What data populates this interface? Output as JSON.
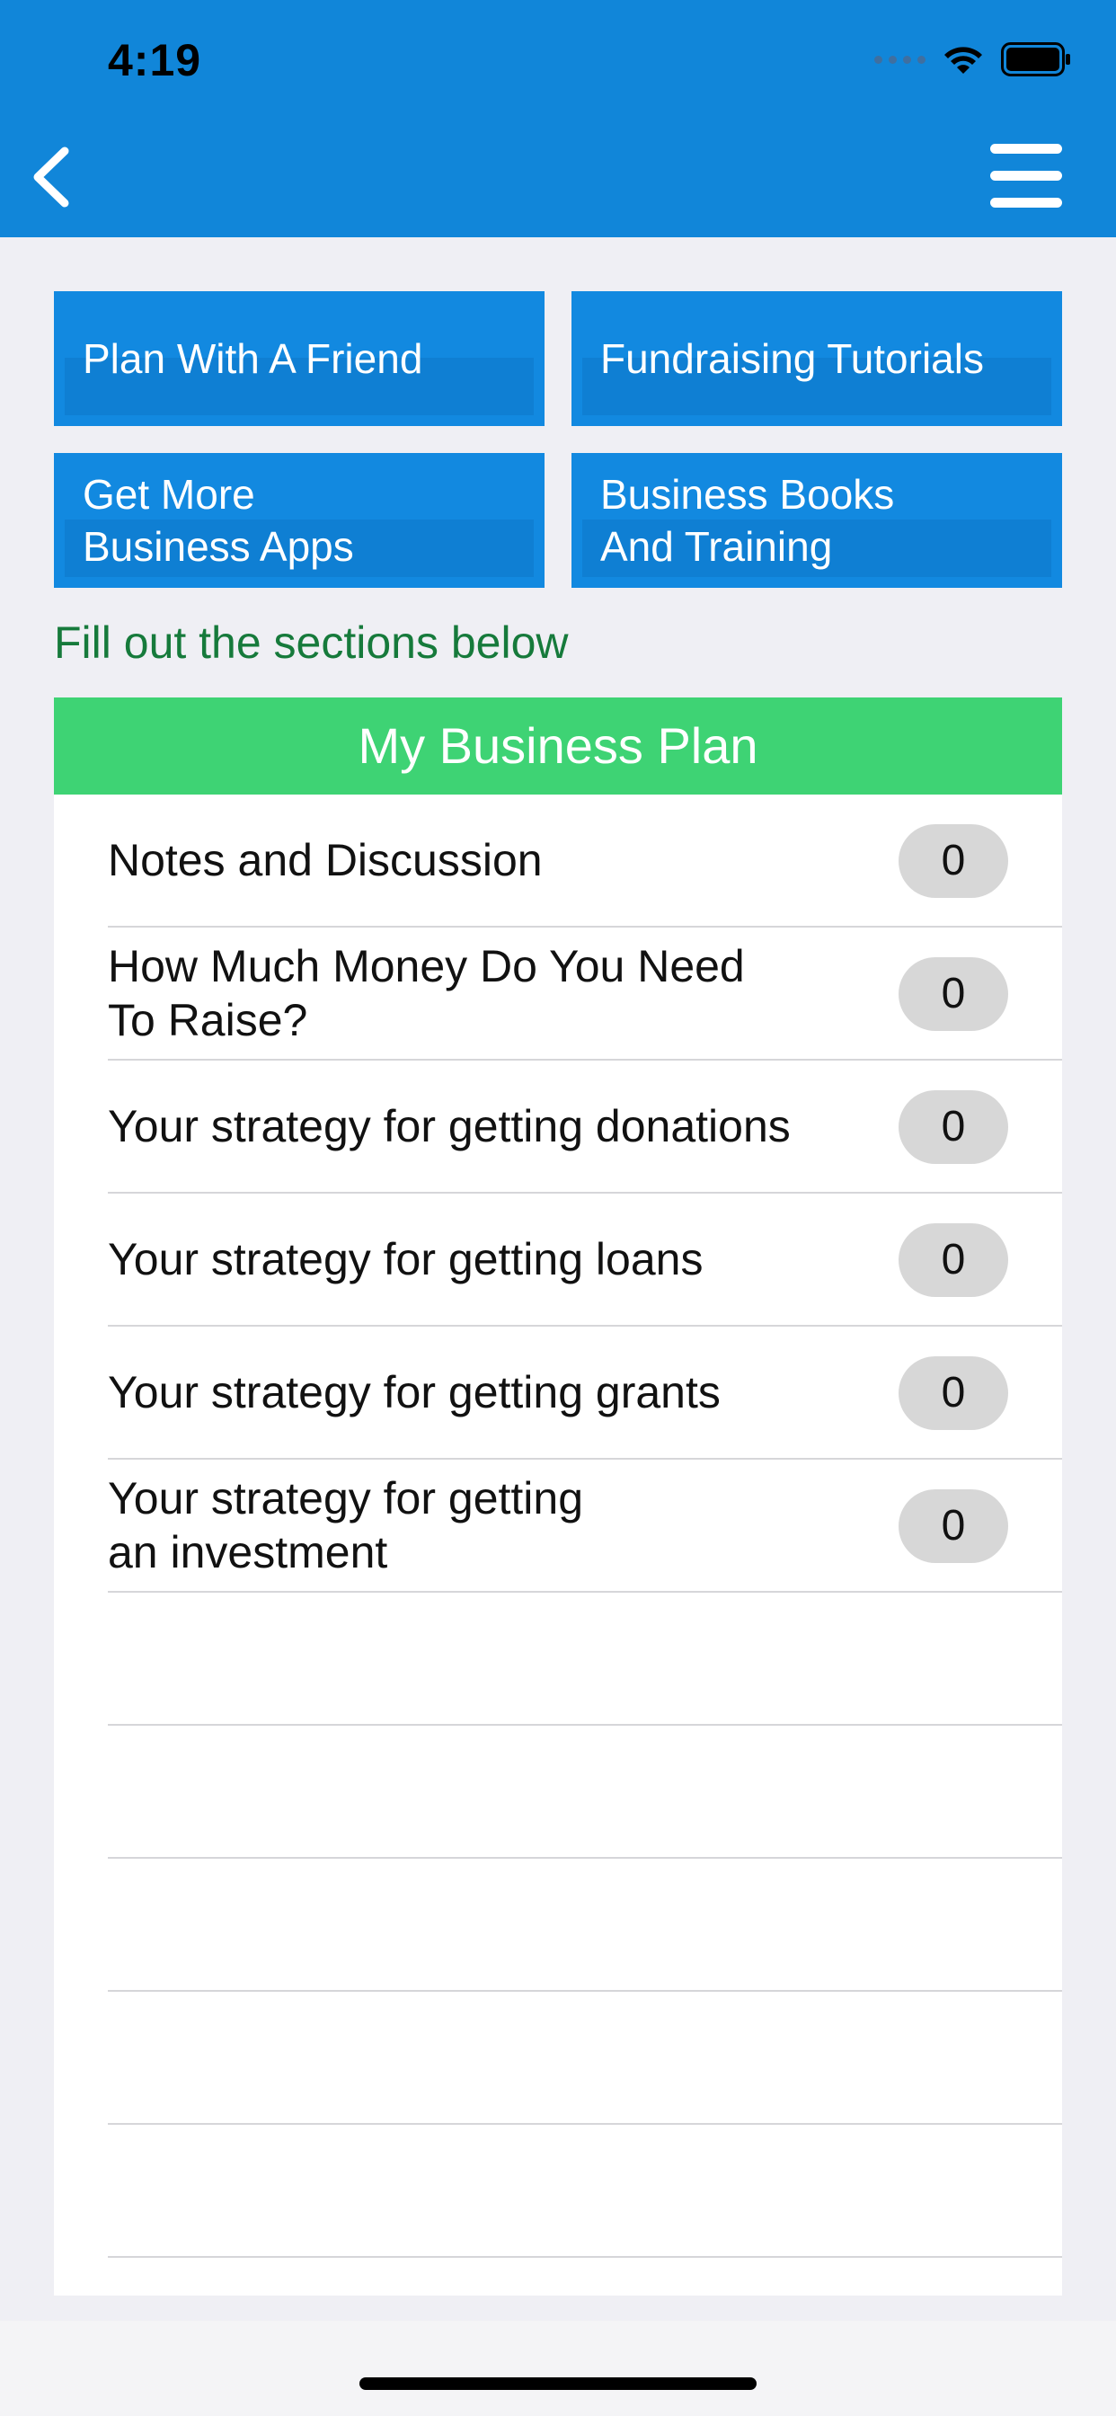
{
  "status_bar": {
    "time": "4:19"
  },
  "nav": {
    "back_icon": "chevron-left-icon",
    "menu_icon": "hamburger-menu-icon"
  },
  "quick_buttons": [
    {
      "label": "Plan With A Friend"
    },
    {
      "label": "Fundraising Tutorials"
    },
    {
      "label": "Get More\nBusiness Apps"
    },
    {
      "label": "Business Books\nAnd Training"
    }
  ],
  "instruction": "Fill out the sections below",
  "plan": {
    "title": "My Business Plan",
    "rows": [
      {
        "label": "Notes and Discussion",
        "count": "0"
      },
      {
        "label": "How Much Money Do You Need\nTo Raise?",
        "count": "0"
      },
      {
        "label": "Your strategy for getting donations",
        "count": "0"
      },
      {
        "label": "Your strategy for getting loans",
        "count": "0"
      },
      {
        "label": "Your strategy for getting grants",
        "count": "0"
      },
      {
        "label": "Your strategy for getting\nan investment",
        "count": "0"
      }
    ]
  },
  "colors": {
    "header": "#1186d9",
    "button": "#1289e0",
    "section_header": "#3ed374",
    "instruction_text": "#167a3b"
  }
}
